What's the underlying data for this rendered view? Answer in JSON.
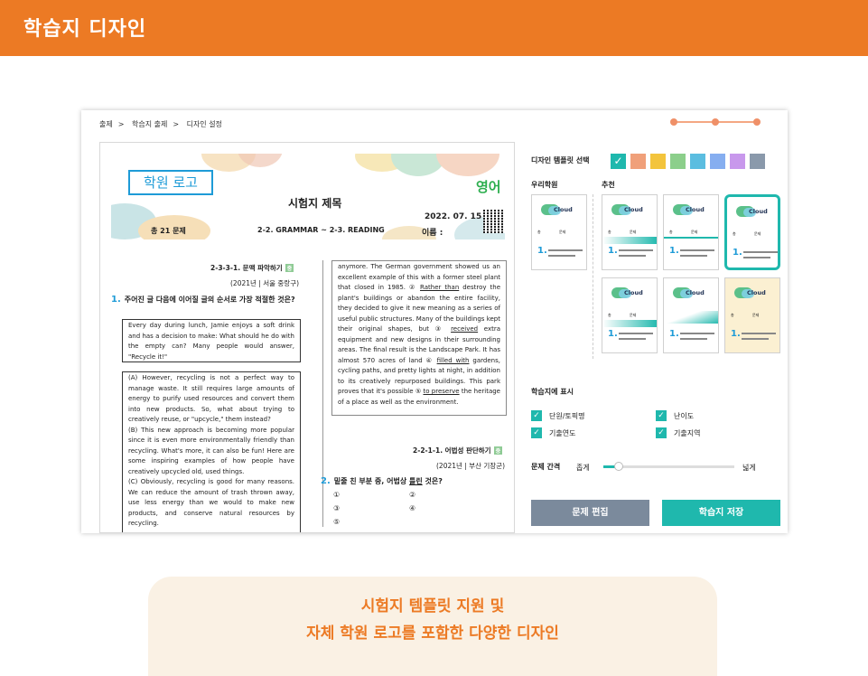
{
  "header": {
    "title": "학습지 디자인"
  },
  "breadcrumb": [
    "출제",
    "학습지 출제",
    "디자인 설정"
  ],
  "breadcrumb_sep": ">",
  "progress": {
    "steps": 3,
    "current": 3
  },
  "paper": {
    "logo": "학원 로고",
    "subject": "영어",
    "title": "시험지 제목",
    "date": "2022. 07. 15",
    "name_label": "이름 :",
    "count": "총 21 문제",
    "range": "2-2. GRAMMAR ~ 2-3. READING",
    "q1": {
      "tag": "2-3-3-1. 문맥 파악하기",
      "level": "중",
      "source": "(2021년 | 서울 중랑구)",
      "num": "1.",
      "text": "주어진 글 다음에 이어질 글의 순서로 가장 적절한 것은?",
      "intro": "Every day during lunch, Jamie enjoys a soft drink and has a decision to make: What should he do with the empty can? Many people would answer, \"Recycle it!\"",
      "a": "(A) However, recycling is not a perfect way to manage waste. It still requires large amounts of energy to purify used resources and convert them into new products. So, what about trying to creatively reuse, or \"upcycle,\" them instead?",
      "b": "(B) This new approach is becoming more popular since it is even more environmentally friendly than recycling. What's more, it can also be fun! Here are some inspiring examples of how people have creatively upcycled old, used things.",
      "c": "(C) Obviously, recycling is good for many reasons. We can reduce the amount of trash thrown away, use less energy than we would to make new products, and conserve natural resources by recycling."
    },
    "passage": [
      "anymore. The German government showed us an excellent example of this with a former steel plant that closed in 1985. ② ",
      "Rather than",
      " destroy the plant's buildings or abandon the entire facility, they decided to give it new meaning as a series of useful public structures. Many of the buildings kept their original shapes, but ③ ",
      "received",
      " extra equipment and new designs in their surrounding areas. The final result is the Landscape Park. It has almost 570 acres of land ④ ",
      "filled with",
      " gardens, cycling paths, and pretty lights at night, in addition to its creatively repurposed buildings. This park proves that it's possible ⑤ ",
      "to preserve",
      " the heritage of a place as well as the environment."
    ],
    "q2": {
      "tag": "2-2-1-1. 어법성 판단하기",
      "level": "중",
      "source": "(2021년 | 부산 기장군)",
      "num": "2.",
      "text_pre": "밑줄 친 부분 중, 어법상 ",
      "text_u": "틀린",
      "text_post": " 것은?",
      "options": [
        "①",
        "②",
        "③",
        "④",
        "⑤"
      ]
    }
  },
  "panel": {
    "template_label": "디자인 템플릿 선택",
    "colors": [
      "#1fb8ad",
      "#f0a07a",
      "#f3c43c",
      "#8ccf8b",
      "#5bbde0",
      "#86aef0",
      "#c898ec",
      "#8a99ab"
    ],
    "mine_label": "우리학원",
    "rec_label": "추천",
    "tpl_brand": "Cloud",
    "tpl_col1": "총",
    "tpl_col2": "문제",
    "tpl_num": "1.",
    "show_label": "학습지에 표시",
    "checks": [
      {
        "label": "단원/토픽명",
        "on": true
      },
      {
        "label": "난이도",
        "on": true
      },
      {
        "label": "기출연도",
        "on": true
      },
      {
        "label": "기출지역",
        "on": true
      }
    ],
    "spacing_label": "문제 간격",
    "narrow": "좁게",
    "wide": "넓게",
    "spacing_value": 0.1,
    "edit_btn": "문제 편집",
    "save_btn": "학습지 저장"
  },
  "caption": [
    "시험지 템플릿 지원 및",
    "자체 학원 로고를 포함한 다양한 디자인"
  ]
}
